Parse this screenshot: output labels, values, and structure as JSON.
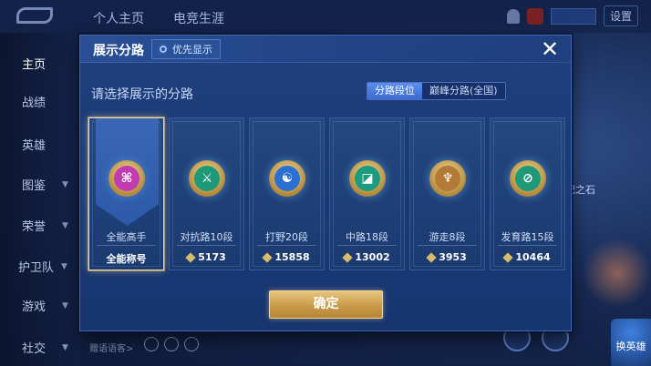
{
  "background": {
    "tabs": [
      "个人主页",
      "电竞生涯"
    ],
    "settings_label": "设置",
    "sidebar": [
      {
        "label": "主页",
        "active": true
      },
      {
        "label": "战绩",
        "active": false
      },
      {
        "label": "英雄",
        "active": false
      },
      {
        "label": "图鉴",
        "active": false
      },
      {
        "label": "荣誉",
        "active": false
      },
      {
        "label": "护卫队",
        "active": false
      },
      {
        "label": "游戏",
        "active": false
      },
      {
        "label": "社交",
        "active": false
      }
    ],
    "bottom_hint": "赠语语客>",
    "right_badge": "记之石",
    "right_button": "换英雄"
  },
  "modal": {
    "title": "展示分路",
    "priority_label": "优先显示",
    "close_icon": "close-icon",
    "prompt": "请选择展示的分路",
    "segments": [
      {
        "label": "分路段位",
        "active": true
      },
      {
        "label": "巅峰分路(全国)",
        "active": false
      }
    ],
    "cards": [
      {
        "label": "全能高手",
        "value": "全能称号",
        "selected": true,
        "icon": "all-rounder-emblem-icon",
        "glyph": "⌘",
        "core_color": "#c23bb0"
      },
      {
        "label": "对抗路10段",
        "value": "5173",
        "selected": false,
        "icon": "clash-lane-emblem-icon",
        "glyph": "⚔",
        "core_color": "#1f9a78"
      },
      {
        "label": "打野20段",
        "value": "15858",
        "selected": false,
        "icon": "jungle-emblem-icon",
        "glyph": "☯",
        "core_color": "#2b6fd1"
      },
      {
        "label": "中路18段",
        "value": "13002",
        "selected": false,
        "icon": "mid-lane-emblem-icon",
        "glyph": "◪",
        "core_color": "#1d9b7f"
      },
      {
        "label": "游走8段",
        "value": "3953",
        "selected": false,
        "icon": "roam-emblem-icon",
        "glyph": "♆",
        "core_color": "#b37a35"
      },
      {
        "label": "发育路15段",
        "value": "10464",
        "selected": false,
        "icon": "farm-lane-emblem-icon",
        "glyph": "⊘",
        "core_color": "#1f9a78"
      }
    ],
    "confirm_label": "确定",
    "colors": {
      "accent_gold": "#c99a48",
      "panel_blue": "#1a3a78",
      "tab_active": "#4a7ce0"
    }
  }
}
